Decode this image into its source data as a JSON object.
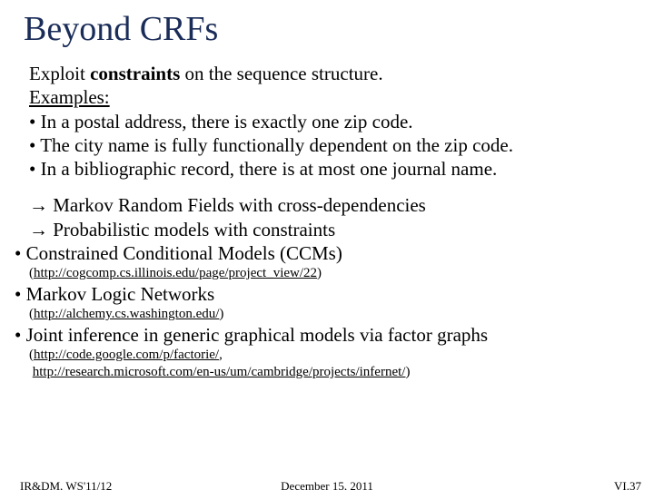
{
  "title": "Beyond CRFs",
  "intro_pre": "Exploit ",
  "intro_bold": "constraints",
  "intro_post": " on the sequence structure.",
  "examples_label": "Examples:",
  "ex1": "• In a postal address, there is exactly one zip code.",
  "ex2": "• The city name is fully functionally dependent on the zip code.",
  "ex3": "• In a bibliographic record, there is at most one journal name.",
  "arrow1": "→ Markov Random Fields with cross-dependencies",
  "arrow2": "→ Probabilistic models with constraints",
  "sub1": "•  Constrained Conditional Models (CCMs)",
  "link1_open": "(",
  "link1": "http://cogcomp.cs.illinois.edu/page/project_view/22",
  "link1_close": ")",
  "sub2": "•  Markov Logic Networks",
  "link2_open": "(",
  "link2": "http://alchemy.cs.washington.edu/",
  "link2_close": ")",
  "sub3": "•  Joint inference in generic graphical models via factor graphs",
  "link3a_open": "(",
  "link3a": "http://code.google.com/p/factorie/",
  "link3a_sep": ", ",
  "link3b": "http://research.microsoft.com/en-us/um/cambridge/projects/infernet/",
  "link3b_close": ")",
  "footer_left": "IR&DM, WS'11/12",
  "footer_center": "December 15, 2011",
  "footer_right": "VI.37"
}
